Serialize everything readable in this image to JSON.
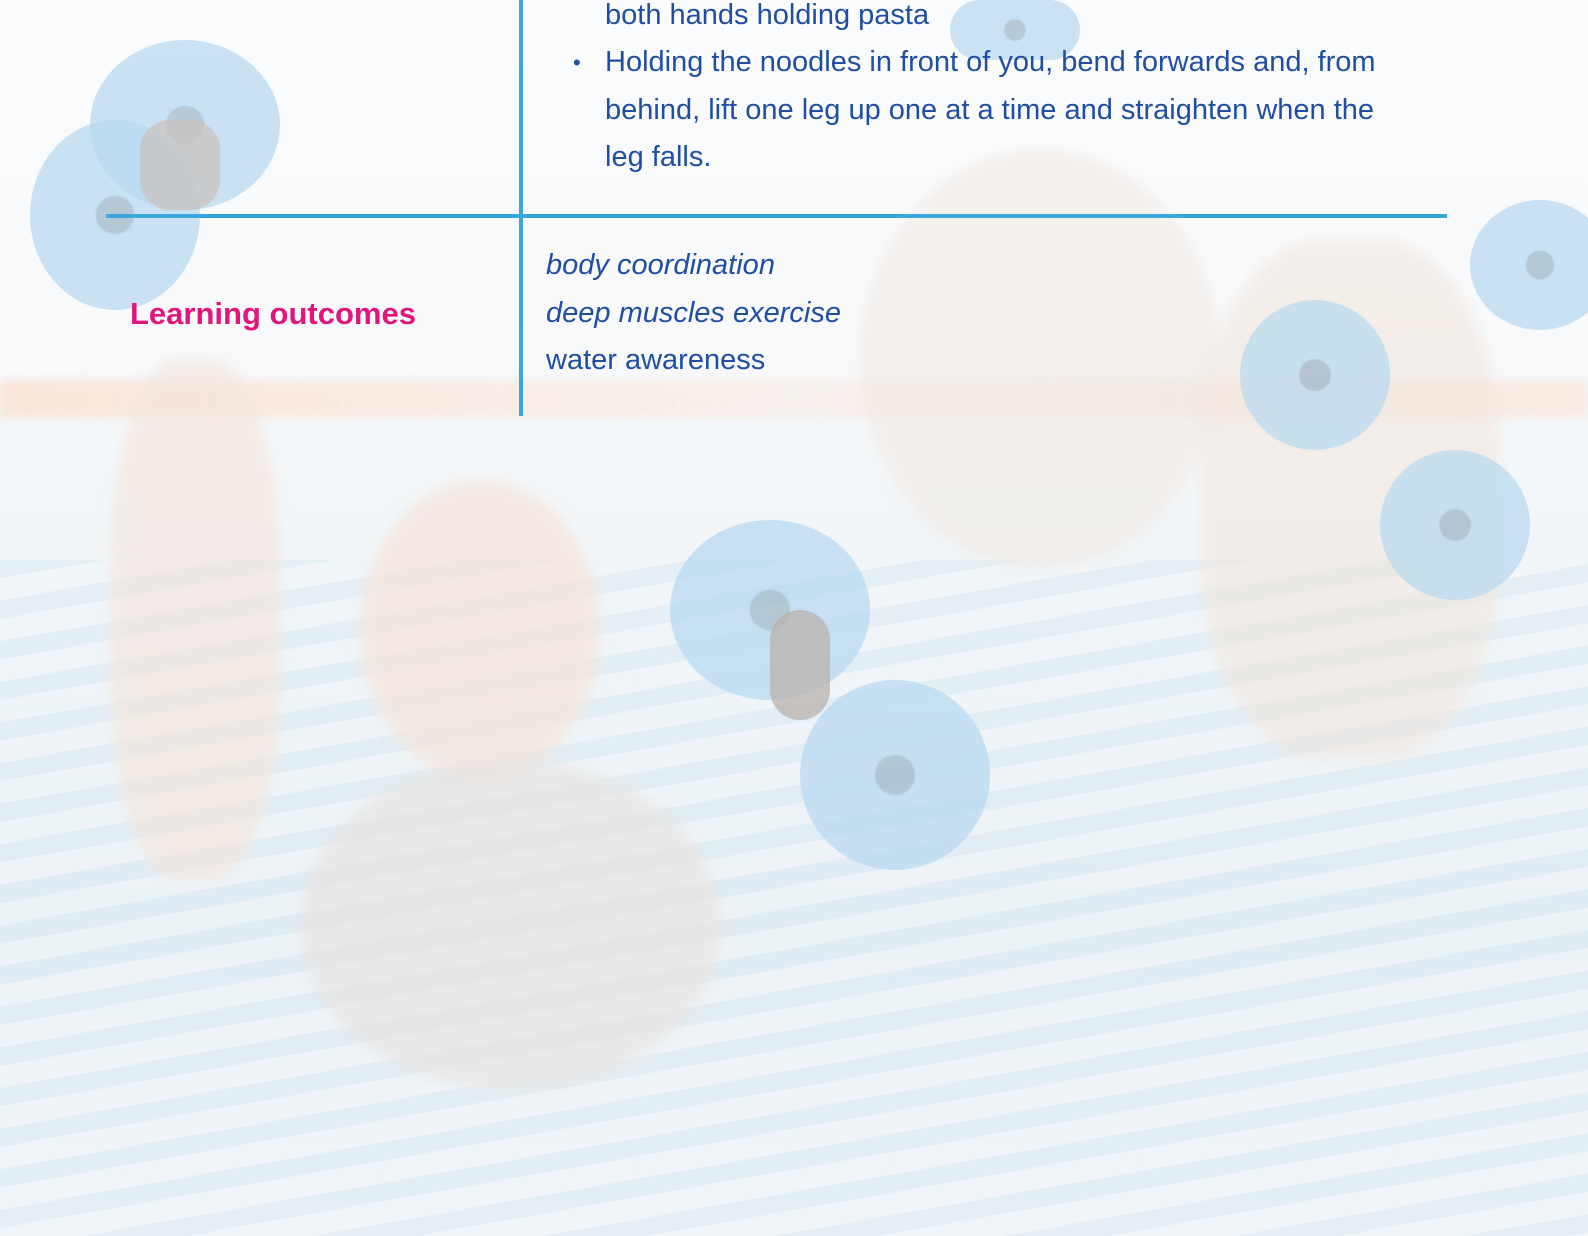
{
  "activity": {
    "description_continuation": "both hands holding pasta",
    "steps": [
      "Holding the noodles in front of you, bend forwards and, from behind, lift one leg up one at a time and straighten when the leg falls."
    ]
  },
  "learning_outcomes": {
    "label": "Learning outcomes",
    "items": [
      {
        "text": "body coordination",
        "style": "italic"
      },
      {
        "text": "deep muscles exercise",
        "style": "italic"
      },
      {
        "text": "water awareness",
        "style": "normal"
      }
    ]
  },
  "colors": {
    "table_rule": "#3aa6dc",
    "body_text": "#1f4ea3",
    "label_text": "#e2157d"
  }
}
